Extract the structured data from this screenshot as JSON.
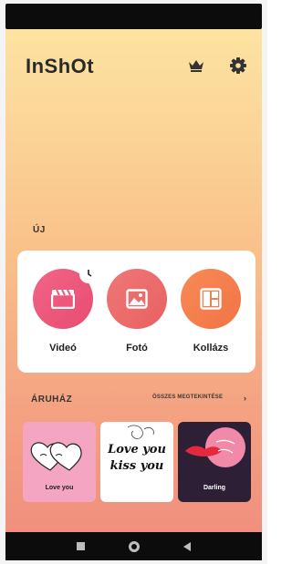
{
  "app": {
    "logo": "InShOt"
  },
  "new_section": {
    "title": "ÚJ",
    "tools": [
      {
        "label": "Videó",
        "icon": "clapperboard-icon",
        "color": "#ec5a7c"
      },
      {
        "label": "Fotó",
        "icon": "image-icon",
        "color": "#ec6a6a"
      },
      {
        "label": "Kollázs",
        "icon": "collage-icon",
        "color": "#f47d4e"
      }
    ]
  },
  "store": {
    "title": "ÁRUHÁZ",
    "see_all": "ÖSSZES MEGTEKINTÉSE",
    "see_all_chevron": "›",
    "stickers": [
      {
        "caption": "Love you",
        "color": "#f3a5c2"
      },
      {
        "caption": "",
        "script": "Love you kiss you",
        "color": "#ffffff"
      },
      {
        "caption": "Darling",
        "color": "#2c1f36"
      }
    ]
  },
  "colors": {
    "gradient_top": "#fde3a1",
    "gradient_bottom": "#f08f7d",
    "card": "#ffffff"
  }
}
